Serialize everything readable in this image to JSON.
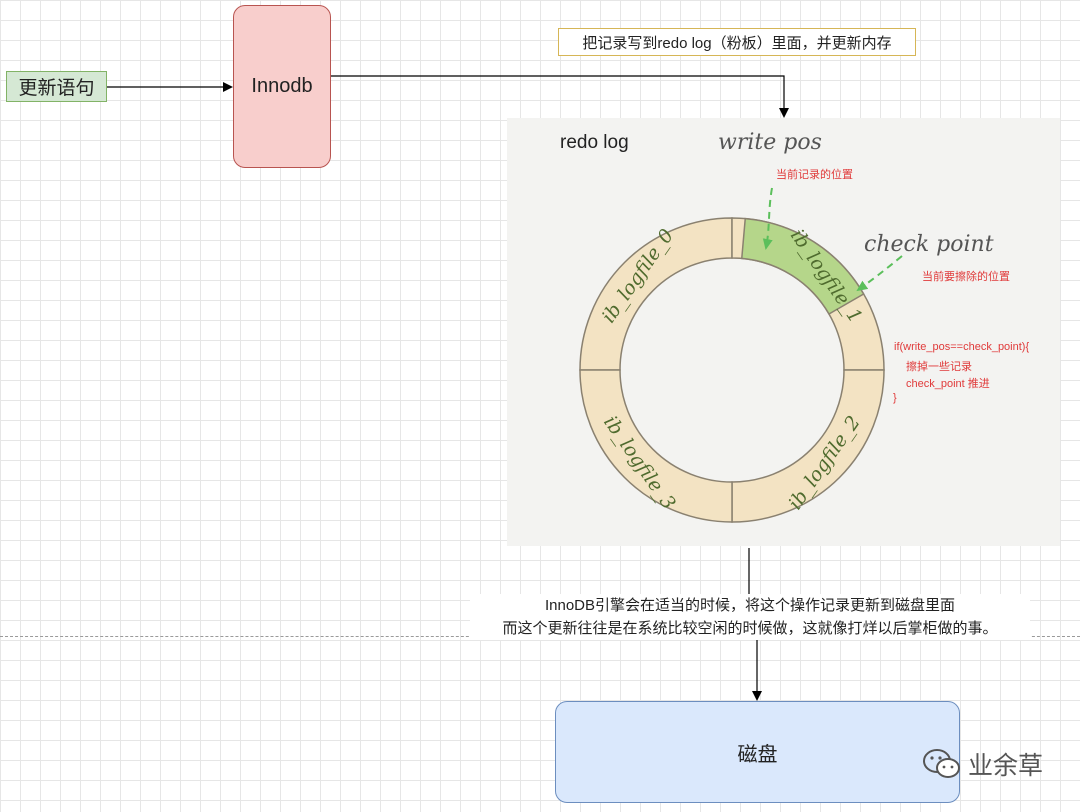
{
  "nodes": {
    "update_statement": "更新语句",
    "innodb": "Innodb",
    "note": "把记录写到redo log（粉板）里面，并更新内存",
    "disk": "磁盘"
  },
  "redo_log": {
    "title": "redo log",
    "write_pos": "write pos",
    "write_pos_desc": "当前记录的位置",
    "check_point": "check point",
    "check_point_desc": "当前要擦除的位置",
    "segments": [
      "ib_logfile_0",
      "ib_logfile_1",
      "ib_logfile_2",
      "ib_logfile_3"
    ],
    "code": [
      "if(write_pos==check_point){",
      "擦掉一些记录",
      "check_point 推进",
      "}"
    ]
  },
  "caption": {
    "line1": "InnoDB引擎会在适当的时候，将这个操作记录更新到磁盘里面",
    "line2": "而这个更新往往是在系统比较空闲的时候做，这就像打烊以后掌柜做的事。"
  },
  "watermark": {
    "text": "业余草"
  },
  "colors": {
    "ring_fill": "#f3e3c3",
    "ring_active": "#b5d68a",
    "ring_stroke": "#8a8170",
    "annotation_red": "#e03a3a",
    "arrow_green": "#5bbf5b"
  }
}
